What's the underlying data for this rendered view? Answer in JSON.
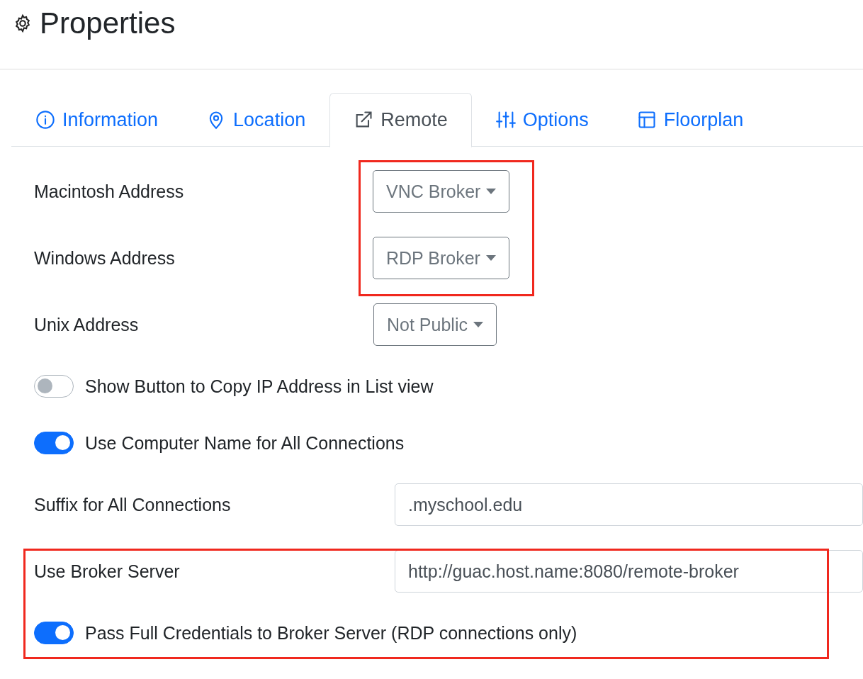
{
  "page": {
    "title": "Properties"
  },
  "tabs": [
    {
      "label": "Information",
      "kind": "info",
      "selected": false
    },
    {
      "label": "Location",
      "kind": "pin",
      "selected": false
    },
    {
      "label": "Remote",
      "kind": "external",
      "selected": true
    },
    {
      "label": "Options",
      "kind": "sliders",
      "selected": false
    },
    {
      "label": "Floorplan",
      "kind": "layout",
      "selected": false
    }
  ],
  "fields": [
    {
      "kind": "dropdown",
      "label": "Macintosh Address",
      "value": "VNC Broker"
    },
    {
      "kind": "dropdown",
      "label": "Windows Address",
      "value": "RDP Broker"
    },
    {
      "kind": "dropdown",
      "label": "Unix Address",
      "value": "Not Public"
    },
    {
      "kind": "toggle",
      "label": "Show Button to Copy IP Address in List view",
      "on": false
    },
    {
      "kind": "toggle",
      "label": "Use Computer Name for All Connections",
      "on": true
    },
    {
      "kind": "text",
      "label": "Suffix for All Connections",
      "value": ".myschool.edu"
    },
    {
      "kind": "text",
      "label": "Use Broker Server",
      "value": "http://guac.host.name:8080/remote-broker"
    },
    {
      "kind": "toggle",
      "label": "Pass Full Credentials to Broker Server (RDP connections only)",
      "on": true
    }
  ]
}
